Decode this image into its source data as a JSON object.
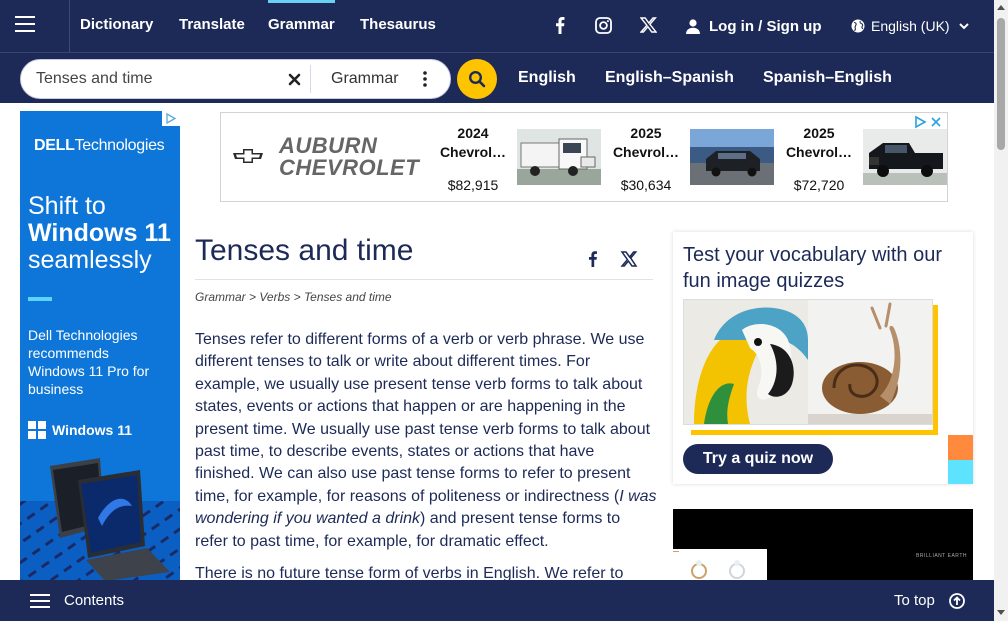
{
  "nav": {
    "links": [
      "Dictionary",
      "Translate",
      "Grammar",
      "Thesaurus"
    ],
    "login": "Log in / Sign up",
    "language": "English (UK)"
  },
  "search": {
    "value": "Tenses and time",
    "scope": "Grammar"
  },
  "dictionaries": [
    "English",
    "English–Spanish",
    "Spanish–English"
  ],
  "left_ad": {
    "brand_bold": "DELL",
    "brand_rest": "Technologies",
    "headline_1": "Shift to",
    "headline_2": "Windows 11",
    "headline_3": "seamlessly",
    "sub": "Dell Technologies recommends Windows 11 Pro for business",
    "windows_label": "Windows 11"
  },
  "top_ad": {
    "dealer_line1": "AUBURN",
    "dealer_line2": "CHEVROLET",
    "cars": [
      {
        "year": "2024",
        "model": "Chevrol…",
        "price": "$82,915"
      },
      {
        "year": "2025",
        "model": "Chevrol…",
        "price": "$30,634"
      },
      {
        "year": "2025",
        "model": "Chevrol…",
        "price": "$72,720"
      }
    ]
  },
  "article": {
    "title": "Tenses and time",
    "breadcrumb": [
      "Grammar",
      "Verbs",
      "Tenses and time"
    ],
    "breadcrumb_sep": " > ",
    "p1_a": "Tenses refer to different forms of a verb or verb phrase. We use different tenses to talk or write about different times. For example, we usually use present tense verb forms to talk about states, events or actions that happen or are happening in the present time. We usually use past tense verb forms to talk about past time, to describe events, states or actions that have finished. We can also use past tense forms to refer to present time, for example, for reasons of politeness or indirectness (",
    "p1_i": "I was wondering if you wanted a drink",
    "p1_b": ") and present tense forms to refer to past time, for example, for dramatic effect.",
    "p2": "There is no future tense form of verbs in English. We refer to"
  },
  "quiz": {
    "title": "Test your vocabulary with our fun image quizzes",
    "button": "Try a quiz now"
  },
  "video_ad": {
    "tag": "BRILLIANT EARTH"
  },
  "bottom": {
    "contents": "Contents",
    "totop": "To top"
  },
  "colors": {
    "navy": "#1d2a57",
    "accent_yellow": "#fec400",
    "active_tab": "#6ad0f2",
    "dell_blue": "#0d76d8"
  }
}
